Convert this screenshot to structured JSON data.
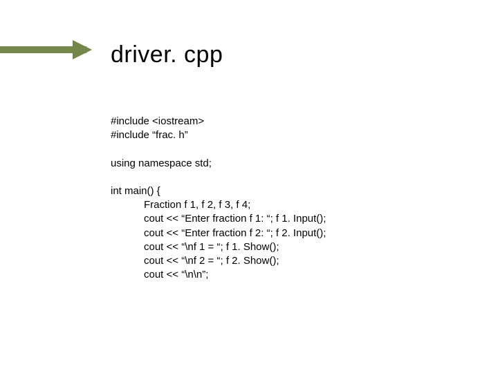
{
  "title": "driver. cpp",
  "includes": {
    "l1": "#include <iostream>",
    "l2": "#include “frac. h”"
  },
  "using_line": "using namespace std;",
  "main": {
    "sig": "int main() {",
    "b1": "Fraction f 1, f 2, f 3, f 4;",
    "b2": "cout << “Enter fraction f 1: “; f 1. Input();",
    "b3": "cout << “Enter fraction f 2: “; f 2. Input();",
    "b4": "cout << “\\nf 1 = “; f 1. Show();",
    "b5": "cout << “\\nf 2 = “; f 2. Show();",
    "b6": "cout << “\\n\\n”;"
  }
}
